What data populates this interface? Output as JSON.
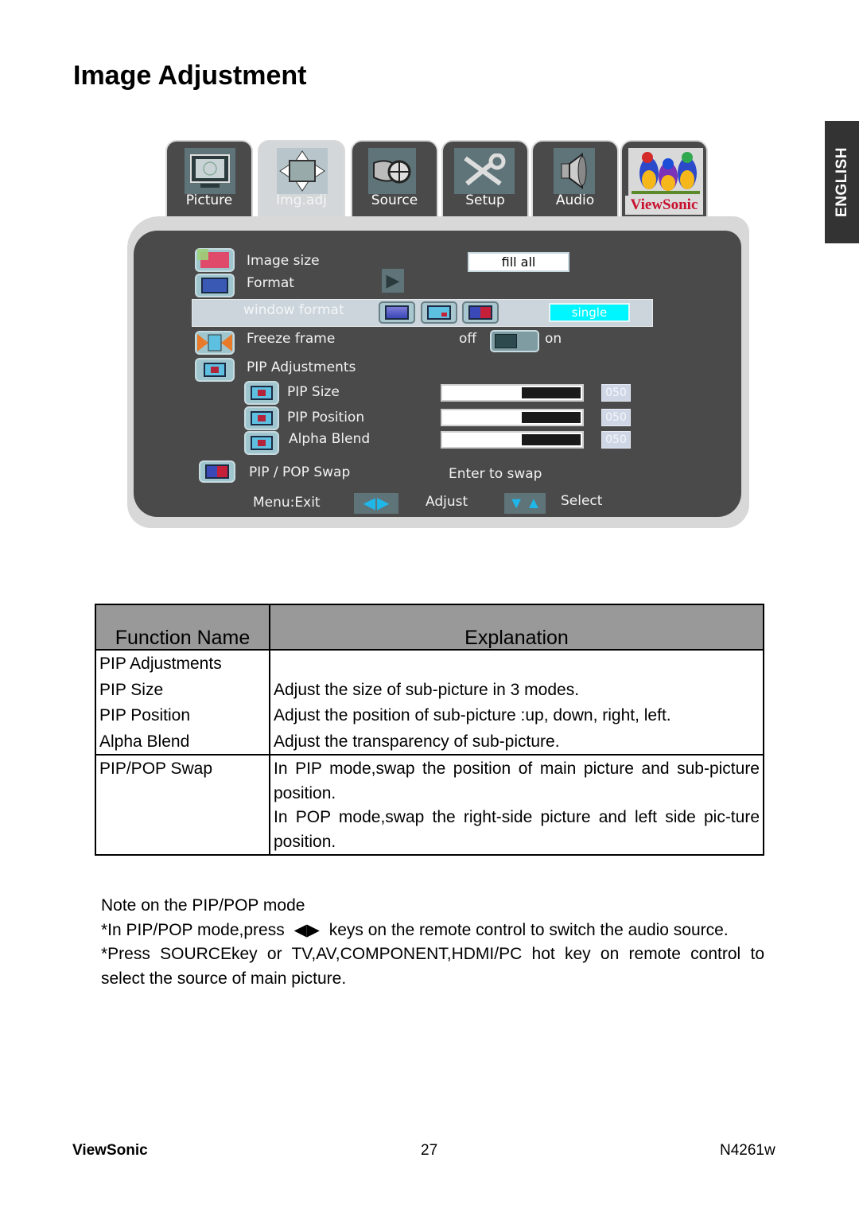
{
  "page": {
    "title": "Image Adjustment",
    "language_tab": "ENGLISH"
  },
  "osd": {
    "tabs": [
      {
        "label": "Picture",
        "icon": "monitor-icon",
        "active": false
      },
      {
        "label": "Img.adj",
        "icon": "image-adjust-arrows-icon",
        "active": true
      },
      {
        "label": "Source",
        "icon": "source-connector-icon",
        "active": false
      },
      {
        "label": "Setup",
        "icon": "tools-icon",
        "active": false
      },
      {
        "label": "Audio",
        "icon": "speaker-icon",
        "active": false
      },
      {
        "label": "ViewSonic",
        "icon": "viewsonic-birds-logo",
        "active": false
      }
    ],
    "menu": {
      "image_size": {
        "label": "Image size",
        "value": "fill all"
      },
      "format": {
        "label": "Format"
      },
      "window_format": {
        "label": "window format",
        "value": "single"
      },
      "freeze_frame": {
        "label": "Freeze frame",
        "off_label": "off",
        "on_label": "on",
        "state": "off"
      },
      "pip_adjustments": {
        "label": "PIP Adjustments"
      },
      "pip_size": {
        "label": "PIP Size",
        "value": "050",
        "level_percent": 50
      },
      "pip_position": {
        "label": "PIP Position",
        "value": "050",
        "level_percent": 50
      },
      "alpha_blend": {
        "label": "Alpha Blend",
        "value": "050",
        "level_percent": 50
      },
      "pip_pop_swap": {
        "label": "PIP / POP Swap",
        "hint": "Enter to swap"
      }
    },
    "footer_hints": {
      "exit": "Menu:Exit",
      "adjust": "Adjust",
      "select": "Select"
    },
    "colors": {
      "panel_bg": "#4a4a4a",
      "highlight_value": "#00f6ff",
      "brand_red": "#c8102e"
    }
  },
  "table": {
    "headers": [
      "Function Name",
      "Explanation"
    ],
    "rows": [
      {
        "name": "PIP Adjustments",
        "explanation": ""
      },
      {
        "name": "PIP Size",
        "explanation": "Adjust the size of sub-picture in 3 modes."
      },
      {
        "name": "PIP Position",
        "explanation": "Adjust the position of sub-picture :up, down, right, left."
      },
      {
        "name": "Alpha Blend",
        "explanation": "Adjust the transparency of sub-picture."
      },
      {
        "name": "PIP/POP Swap",
        "explanation_lines": [
          "In PIP mode,swap the position of main picture and sub-picture position.",
          "In POP mode,swap the right-side picture and left side pic-ture position."
        ]
      }
    ]
  },
  "notes": {
    "title": "Note on the PIP/POP mode",
    "line1_pre": "*In PIP/POP mode,press",
    "line1_keys": "◀▶",
    "line1_post": "keys  on the remote control to switch the audio source.",
    "line2": "*Press SOURCEkey or TV,AV,COMPONENT,HDMI/PC hot key on remote control to select the source of main picture."
  },
  "footer": {
    "brand": "ViewSonic",
    "page_number": "27",
    "model": "N4261w"
  }
}
